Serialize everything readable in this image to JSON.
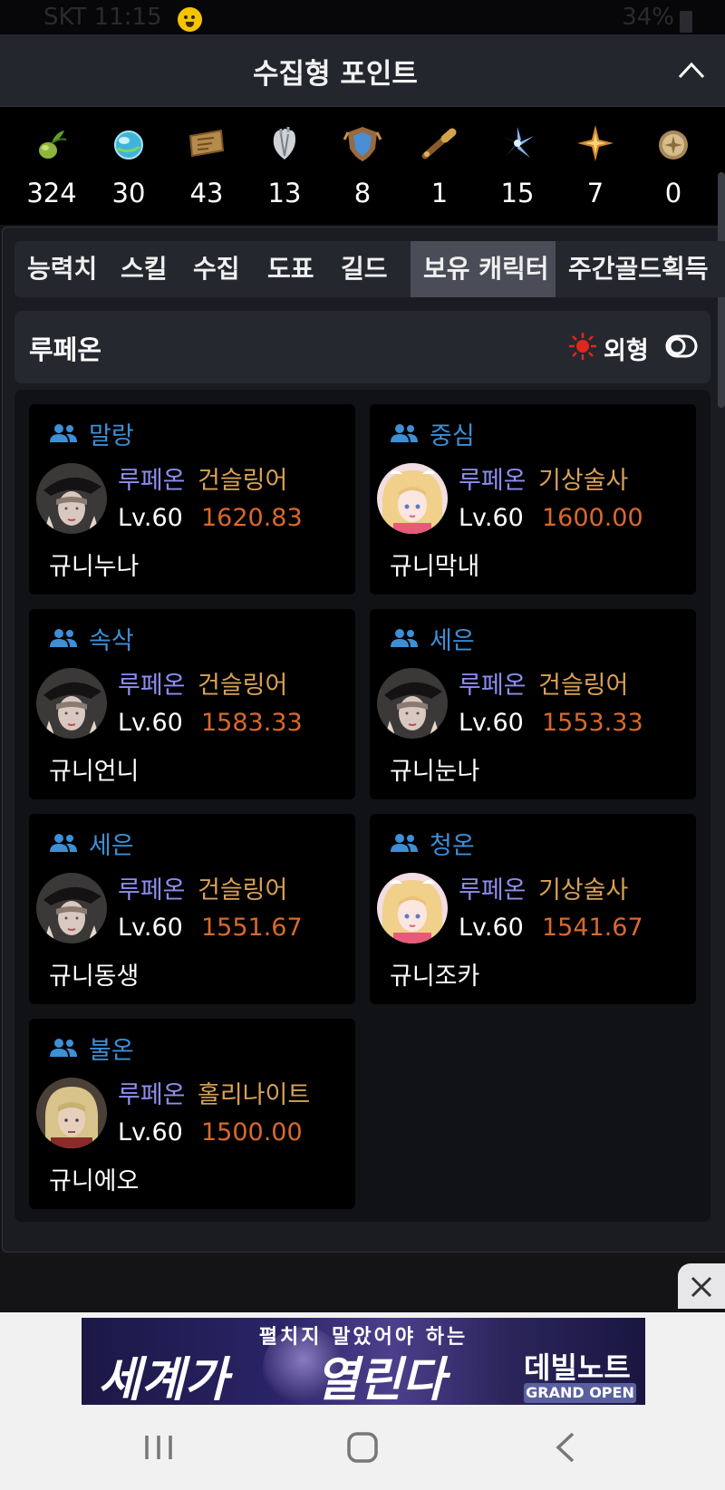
{
  "status_bar": {
    "left_text": "SKT 11:15",
    "right_text": "34%"
  },
  "header": {
    "title": "수집형 포인트"
  },
  "points": [
    {
      "icon": "seed-icon",
      "value": "324"
    },
    {
      "icon": "orb-icon",
      "value": "30"
    },
    {
      "icon": "map-icon",
      "value": "43"
    },
    {
      "icon": "heart-icon",
      "value": "13"
    },
    {
      "icon": "shield-icon",
      "value": "8"
    },
    {
      "icon": "telescope-icon",
      "value": "1"
    },
    {
      "icon": "leaf-icon",
      "value": "15"
    },
    {
      "icon": "star-icon",
      "value": "7"
    },
    {
      "icon": "medal-icon",
      "value": "0"
    }
  ],
  "tabs": [
    {
      "label": "능력치"
    },
    {
      "label": "스킬"
    },
    {
      "label": "수집"
    },
    {
      "label": "도표"
    },
    {
      "label": "길드"
    },
    {
      "label": "보유 캐릭터"
    },
    {
      "label": "주간골드획득"
    }
  ],
  "active_tab": "보유 캐릭터",
  "server_group": {
    "name": "루페온",
    "toggle_label": "외형"
  },
  "characters": [
    {
      "guild": "말랑",
      "server": "루페온",
      "class": "건슬링어",
      "level": "Lv.60",
      "item_level": "1620.83",
      "name": "규니누나",
      "avatar": "gunslinger"
    },
    {
      "guild": "중심",
      "server": "루페온",
      "class": "기상술사",
      "level": "Lv.60",
      "item_level": "1600.00",
      "name": "규니막내",
      "avatar": "aeromancer"
    },
    {
      "guild": "속삭",
      "server": "루페온",
      "class": "건슬링어",
      "level": "Lv.60",
      "item_level": "1583.33",
      "name": "규니언니",
      "avatar": "gunslinger"
    },
    {
      "guild": "세은",
      "server": "루페온",
      "class": "건슬링어",
      "level": "Lv.60",
      "item_level": "1553.33",
      "name": "규니눈나",
      "avatar": "gunslinger"
    },
    {
      "guild": "세은",
      "server": "루페온",
      "class": "건슬링어",
      "level": "Lv.60",
      "item_level": "1551.67",
      "name": "규니동생",
      "avatar": "gunslinger"
    },
    {
      "guild": "청온",
      "server": "루페온",
      "class": "기상술사",
      "level": "Lv.60",
      "item_level": "1541.67",
      "name": "규니조카",
      "avatar": "aeromancer"
    },
    {
      "guild": "불온",
      "server": "루페온",
      "class": "홀리나이트",
      "level": "Lv.60",
      "item_level": "1500.00",
      "name": "규니에오",
      "avatar": "paladin"
    }
  ],
  "ad": {
    "subtitle": "펼치지 말았어야 하는",
    "headline_1": "세계가",
    "headline_2": "열린다",
    "logo": "데빌노트",
    "badge": "GRAND OPEN"
  },
  "colors": {
    "guild": "#3d8fd6",
    "server": "#8d8ef0",
    "class": "#d9a155",
    "item_level": "#d8692b",
    "active_tab": "#4a4d57"
  }
}
